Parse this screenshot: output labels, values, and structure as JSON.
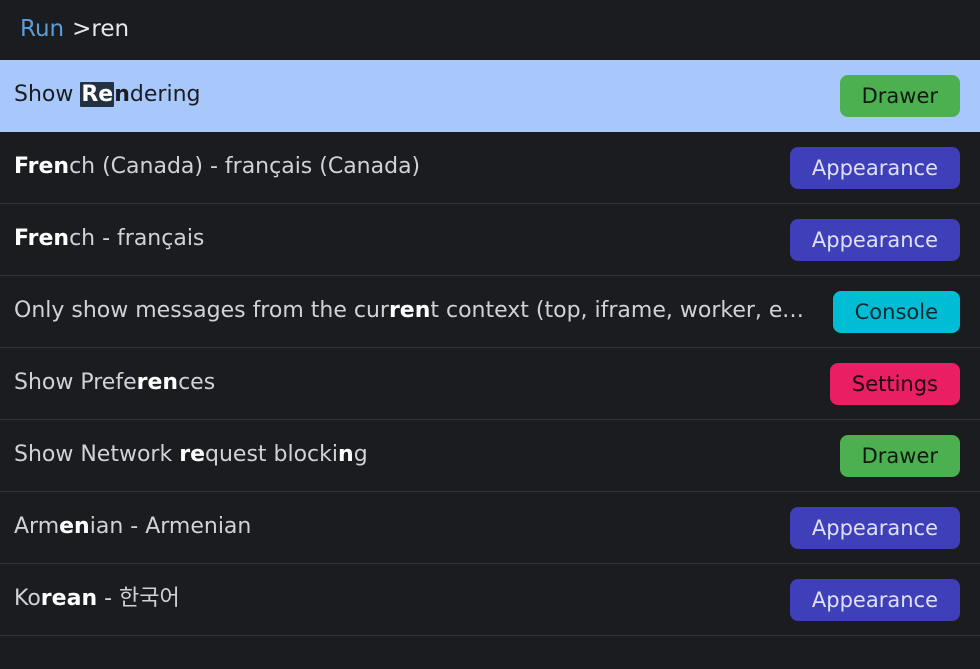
{
  "header": {
    "run_label": "Run",
    "prompt": ">",
    "query": "ren"
  },
  "badges": {
    "drawer": {
      "class": "badge-drawer",
      "label": "Drawer"
    },
    "appearance": {
      "class": "badge-appearance",
      "label": "Appearance"
    },
    "console": {
      "class": "badge-console",
      "label": "Console"
    },
    "settings": {
      "class": "badge-settings",
      "label": "Settings"
    }
  },
  "items": [
    {
      "selected": true,
      "segments": [
        {
          "text": "Show "
        },
        {
          "text": "Re",
          "bold": true,
          "cursor": true
        },
        {
          "text": "n",
          "bold": true
        },
        {
          "text": "dering"
        }
      ],
      "badge": "drawer"
    },
    {
      "segments": [
        {
          "text": "F",
          "bold": true
        },
        {
          "text": "ren",
          "bold": true
        },
        {
          "text": "ch (Canada) - français (Canada)"
        }
      ],
      "badge": "appearance"
    },
    {
      "segments": [
        {
          "text": "F",
          "bold": true
        },
        {
          "text": "ren",
          "bold": true
        },
        {
          "text": "ch - français"
        }
      ],
      "badge": "appearance"
    },
    {
      "segments": [
        {
          "text": "Only show messages from the cur"
        },
        {
          "text": "ren",
          "bold": true
        },
        {
          "text": "t context (top, iframe, worker, extensi…"
        }
      ],
      "badge": "console"
    },
    {
      "segments": [
        {
          "text": "Show Prefe"
        },
        {
          "text": "ren",
          "bold": true
        },
        {
          "text": "ces"
        }
      ],
      "badge": "settings"
    },
    {
      "segments": [
        {
          "text": "Show Network "
        },
        {
          "text": "re",
          "bold": true
        },
        {
          "text": "quest blocki"
        },
        {
          "text": "n",
          "bold": true
        },
        {
          "text": "g"
        }
      ],
      "badge": "drawer"
    },
    {
      "segments": [
        {
          "text": "Arm"
        },
        {
          "text": "en",
          "bold": true
        },
        {
          "text": "ian - Armenian"
        }
      ],
      "badge": "appearance"
    },
    {
      "segments": [
        {
          "text": "Ko"
        },
        {
          "text": "r",
          "bold": true
        },
        {
          "text": "ea",
          "bold": true
        },
        {
          "text": "n",
          "bold": true
        },
        {
          "text": " - 한국어"
        }
      ],
      "badge": "appearance"
    }
  ]
}
